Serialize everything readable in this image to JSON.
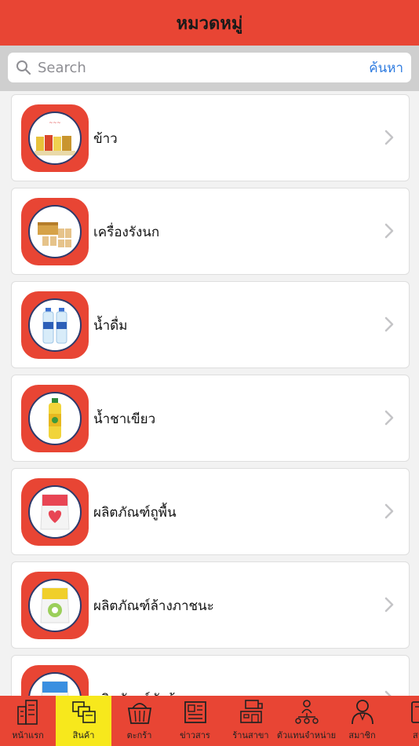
{
  "header": {
    "title": "หมวดหมู่"
  },
  "search": {
    "placeholder": "Search",
    "button_label": "ค้นหา"
  },
  "categories": [
    {
      "label": "ข้าว",
      "icon": "rice-product-icon"
    },
    {
      "label": "เครื่องรังนก",
      "icon": "birdnest-product-icon"
    },
    {
      "label": "น้ำดื่ม",
      "icon": "water-bottle-icon"
    },
    {
      "label": "น้ำชาเขียว",
      "icon": "green-tea-bottle-icon"
    },
    {
      "label": "ผลิตภัณฑ์ถูพื้น",
      "icon": "floor-cleaner-icon"
    },
    {
      "label": "ผลิตภัณฑ์ล้างภาชนะ",
      "icon": "dishwash-icon"
    },
    {
      "label": "ผลิตภัณฑ์ซักผ้า",
      "icon": "detergent-icon"
    }
  ],
  "tabs": [
    {
      "label": "หน้าแรก",
      "icon": "home-building-icon",
      "active": false
    },
    {
      "label": "สินค้า",
      "icon": "products-icon",
      "active": true
    },
    {
      "label": "ตะกร้า",
      "icon": "basket-icon",
      "active": false
    },
    {
      "label": "ข่าวสาร",
      "icon": "newspaper-icon",
      "active": false
    },
    {
      "label": "ร้านสาขา",
      "icon": "branch-store-icon",
      "active": false
    },
    {
      "label": "ตัวแทนจำหน่าย",
      "icon": "dealer-network-icon",
      "active": false
    },
    {
      "label": "สมาชิก",
      "icon": "member-icon",
      "active": false
    },
    {
      "label": "สา",
      "icon": "more-icon",
      "active": false
    }
  ],
  "colors": {
    "primary": "#e84534",
    "active_tab": "#f7e81c",
    "link": "#2f7ce0"
  }
}
